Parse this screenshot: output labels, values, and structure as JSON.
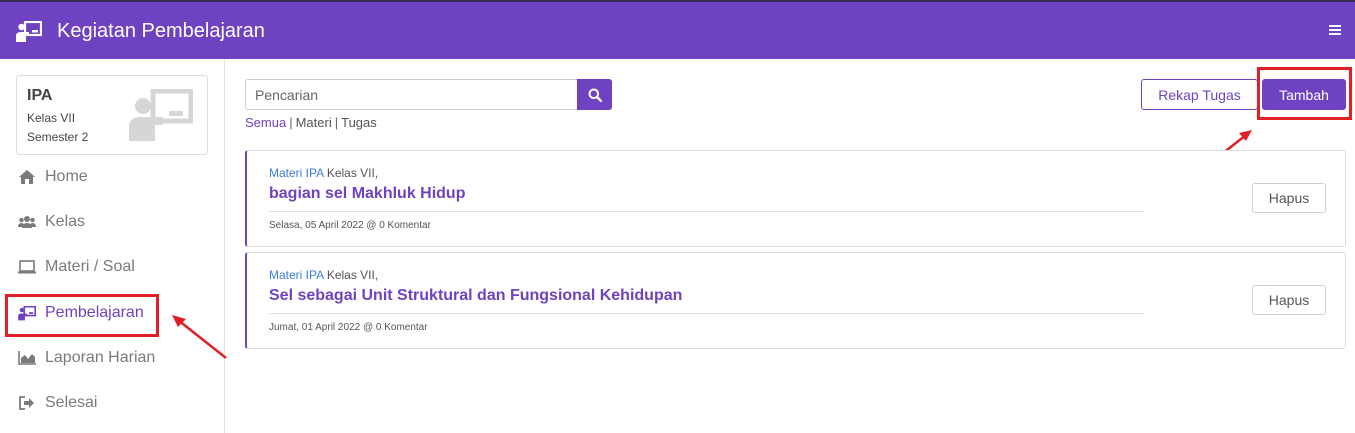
{
  "header": {
    "title": "Kegiatan Pembelajaran",
    "icon": "presentation-icon",
    "menu_icon": "hamburger-icon",
    "bg_color": "#6f42c1"
  },
  "class_card": {
    "subject": "IPA",
    "grade": "Kelas VII",
    "semester": "Semester 2",
    "icon": "teacher-board-icon"
  },
  "sidebar": {
    "items": [
      {
        "label": "Home",
        "icon": "home-icon",
        "active": false
      },
      {
        "label": "Kelas",
        "icon": "users-icon",
        "active": false
      },
      {
        "label": "Materi / Soal",
        "icon": "laptop-icon",
        "active": false
      },
      {
        "label": "Pembelajaran",
        "icon": "presentation-icon",
        "active": true
      },
      {
        "label": "Laporan Harian",
        "icon": "area-chart-icon",
        "active": false
      },
      {
        "label": "Selesai",
        "icon": "sign-out-icon",
        "active": false
      }
    ]
  },
  "search": {
    "placeholder": "Pencarian",
    "value": "",
    "button_icon": "search-icon"
  },
  "filters": {
    "all": "Semua",
    "material": "Materi",
    "task": "Tugas",
    "separator": "|"
  },
  "toolbar": {
    "rekap_label": "Rekap Tugas",
    "add_label": "Tambah"
  },
  "items": [
    {
      "meta_prefix": "Materi IPA",
      "meta_suffix": "Kelas VII,",
      "title": "bagian sel Makhluk Hidup",
      "footer": "Selasa, 05 April 2022 @ 0 Komentar",
      "delete_label": "Hapus"
    },
    {
      "meta_prefix": "Materi IPA",
      "meta_suffix": "Kelas VII,",
      "title": "Sel sebagai Unit Struktural dan Fungsional Kehidupan",
      "footer": "Jumat, 01 April 2022 @ 0 Komentar",
      "delete_label": "Hapus"
    }
  ],
  "colors": {
    "primary": "#6f42c1",
    "annotation": "#e21f26",
    "link": "#3b7dd8"
  }
}
